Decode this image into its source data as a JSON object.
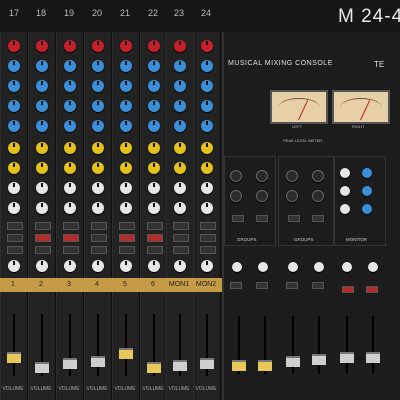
{
  "header": {
    "channel_numbers": [
      "17",
      "18",
      "19",
      "20",
      "21",
      "22",
      "23",
      "24"
    ],
    "model": "M 24-4"
  },
  "tape_labels": [
    "1",
    "2",
    "3",
    "4",
    "5",
    "6",
    "MON1",
    "MON2"
  ],
  "fader_label": "VOLUME",
  "master": {
    "title": "MUSICAL MIXING CONSOLE",
    "brand": "TE",
    "meter_left_label": "LEFT",
    "meter_right_label": "RIGHT",
    "peak_label": "PEAK LEVEL METER",
    "groups_label": "GROUPS",
    "monitor_label": "MONITOR"
  },
  "colors": {
    "cap_red": "#c8202a",
    "cap_blue": "#3a8fd8",
    "cap_yellow": "#e3c21d",
    "cap_white": "#e6e6e6",
    "meter_face": "#e7d0a8",
    "tape": "#d8a84a"
  }
}
